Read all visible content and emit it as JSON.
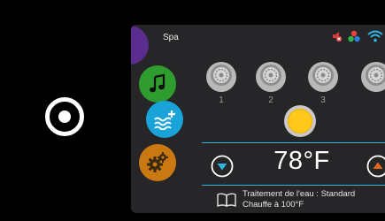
{
  "screen": {
    "title": "Spa"
  },
  "colors": {
    "accent": "#2fb6e0",
    "menu_music": "#2e9c2e",
    "menu_water": "#1aa3d8",
    "menu_settings": "#c97812",
    "menu_top": "#5b2d8e",
    "light": "#ffc81a",
    "temp_down": "#2fb6e0",
    "temp_up": "#e06a1a"
  },
  "icons": {
    "status": [
      "no-sound-icon",
      "color-dots-icon",
      "wifi-icon"
    ],
    "menu": [
      "music-note-icon",
      "water-heat-icon",
      "gear-icon"
    ],
    "home": "home-button-icon"
  },
  "jets": {
    "labels": [
      "1",
      "2",
      "3"
    ]
  },
  "temperature": {
    "value": "78°F"
  },
  "info": {
    "line1": "Traitement de l'eau : Standard",
    "line2": "Chauffe à 100°F"
  }
}
